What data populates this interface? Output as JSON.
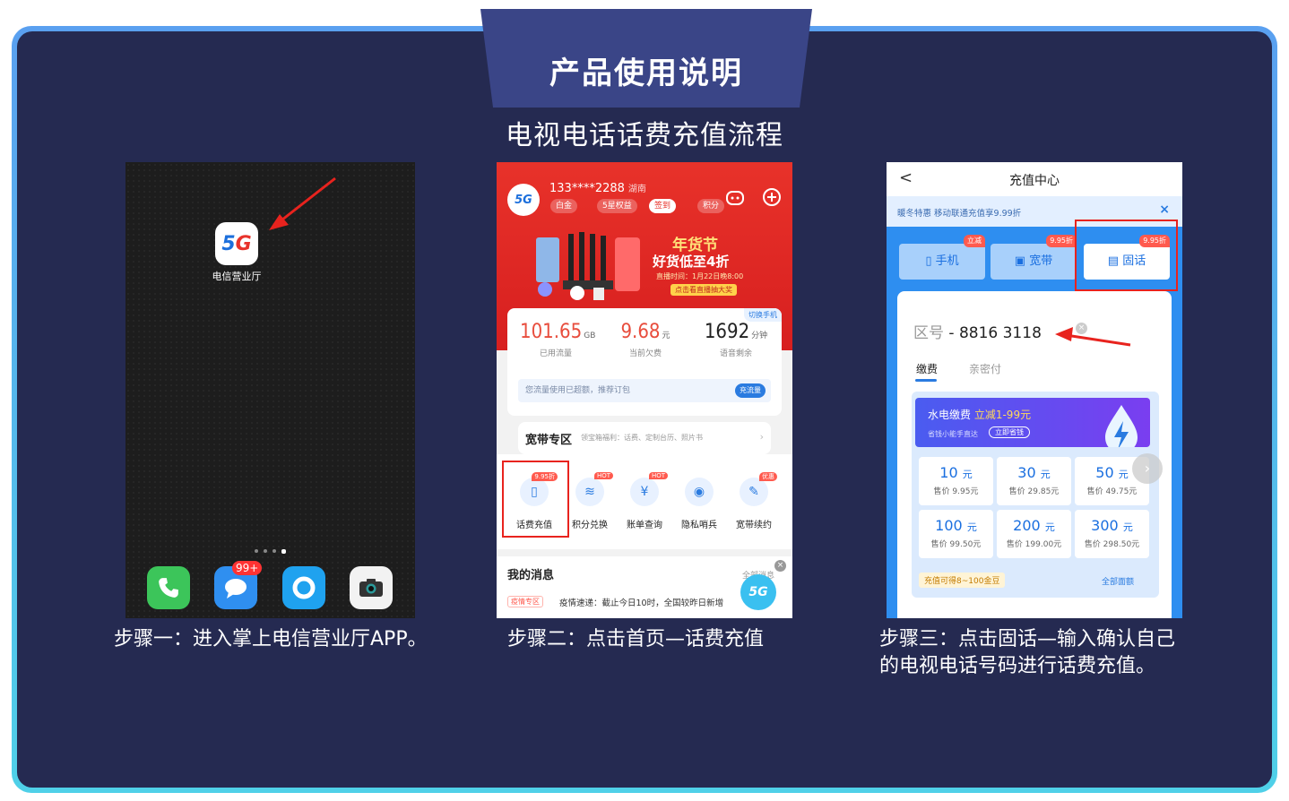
{
  "header": {
    "title": "产品使用说明",
    "subtitle": "电视电话话费充值流程"
  },
  "steps": [
    {
      "caption": "步骤一：进入掌上电信营业厅APP。"
    },
    {
      "caption": "步骤二：点击首页—话费充值"
    },
    {
      "caption_line1": "步骤三：点击固话—输入确认自己",
      "caption_line2": "的电视电话号码进行话费充值。"
    }
  ],
  "phone1": {
    "app_label": "电信营业厅",
    "app_icon_text_a": "5",
    "app_icon_text_b": "G",
    "message_badge": "99+",
    "dock_icons": [
      "phone-icon",
      "message-icon",
      "browser-icon",
      "camera-icon"
    ]
  },
  "phone2": {
    "avatar_text": "5G",
    "phone_number": "133****2288",
    "region": "湖南",
    "chips": [
      "白金",
      "5星权益",
      "签到",
      "积分"
    ],
    "banner": {
      "line1": "年货节",
      "line2": "好货低至4折",
      "line3": "直播时间：1月22日晚8:00",
      "line4": "点击看直播抽大奖"
    },
    "switch_label": "切换手机",
    "stats": [
      {
        "value": "101.65",
        "unit": "GB",
        "label": "已用流量"
      },
      {
        "value": "9.68",
        "unit": "元",
        "label": "当前欠费"
      },
      {
        "value": "1692",
        "unit": "分钟",
        "label": "语音剩余"
      }
    ],
    "tip": "您流量使用已超额，推荐订包",
    "tip_button": "充流量",
    "broadband_title": "宽带专区",
    "broadband_sub": "领宝箱福利：话费、定制台历、照片书",
    "icons": [
      {
        "label": "话费充值",
        "tag": "9.95折",
        "glyph": "▯"
      },
      {
        "label": "积分兑换",
        "tag": "HOT",
        "glyph": "≋"
      },
      {
        "label": "账单查询",
        "tag": "HOT",
        "glyph": "¥"
      },
      {
        "label": "隐私哨兵",
        "tag": "",
        "glyph": "◉"
      },
      {
        "label": "宽带续约",
        "tag": "优惠",
        "glyph": "✎"
      }
    ],
    "messages_title": "我的消息",
    "messages_all": "全部消息",
    "message_tag": "疫情专区",
    "message_text": "疫情速递：截止今日10时，全国较昨日新增"
  },
  "phone3": {
    "title": "充值中心",
    "back": "<",
    "notice": "暖冬特惠 移动联通充值享9.99折",
    "tabs": [
      {
        "label": "手机",
        "tag": "立减"
      },
      {
        "label": "宽带",
        "tag": "9.95折"
      },
      {
        "label": "固话",
        "tag": "9.95折"
      }
    ],
    "area_label": "区号",
    "phone_value": "8816 3118",
    "subtabs": [
      "缴费",
      "亲密付"
    ],
    "promo_title": "水电缴费",
    "promo_highlight": "立减1-99元",
    "promo_sub": "省钱小能手直达",
    "promo_button": "立即省钱",
    "tiles": [
      {
        "value": "10",
        "unit": "元",
        "price": "售价 9.95元"
      },
      {
        "value": "30",
        "unit": "元",
        "price": "售价 29.85元"
      },
      {
        "value": "50",
        "unit": "元",
        "price": "售价 49.75元"
      },
      {
        "value": "100",
        "unit": "元",
        "price": "售价 99.50元"
      },
      {
        "value": "200",
        "unit": "元",
        "price": "售价 199.00元"
      },
      {
        "value": "300",
        "unit": "元",
        "price": "售价 298.50元"
      }
    ],
    "gold_tip": "充值可得8~100金豆",
    "all_values": "全部面额"
  },
  "colors": {
    "background": "#252a51",
    "frame": "#5aa0f0",
    "accent_red": "#e8231e",
    "accent_blue": "#2a7be0"
  }
}
